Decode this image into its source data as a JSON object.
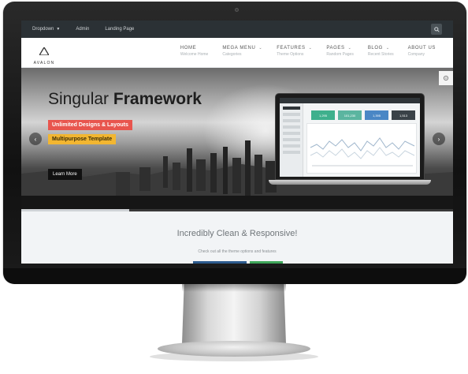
{
  "topbar": {
    "items": [
      {
        "label": "Dropdown",
        "chevron": true
      },
      {
        "label": "Admin",
        "chevron": false
      },
      {
        "label": "Landing Page",
        "chevron": false
      }
    ],
    "search_icon": "search-icon"
  },
  "logo": {
    "text": "AVALON"
  },
  "nav": [
    {
      "title": "HOME",
      "sub": "Welcome Home",
      "chevron": false
    },
    {
      "title": "MEGA MENU",
      "sub": "Categories",
      "chevron": true
    },
    {
      "title": "FEATURES",
      "sub": "Theme Options",
      "chevron": true
    },
    {
      "title": "PAGES",
      "sub": "Random Pages",
      "chevron": true
    },
    {
      "title": "BLOG",
      "sub": "Recent Stories",
      "chevron": true
    },
    {
      "title": "ABOUT US",
      "sub": "Company",
      "chevron": false
    }
  ],
  "hero": {
    "title_regular": "Singular",
    "title_bold": "Framework",
    "tag1": "Unlimited Designs & Layouts",
    "tag2": "Multipurpose Template",
    "button": "Learn More",
    "progress": 0.25
  },
  "laptop": {
    "stats": [
      {
        "value": "1,295",
        "color": "#3fb08d"
      },
      {
        "value": "101,230",
        "color": "#5bb5a0"
      },
      {
        "value": "1,395",
        "color": "#4a87c5"
      },
      {
        "value": "1,513",
        "color": "#3a4248"
      }
    ]
  },
  "section": {
    "title": "Incredibly Clean & Responsive!",
    "subtitle": "Check out all the theme options and features"
  },
  "colors": {
    "topbar": "#2b3135",
    "tag_red": "#e8554e",
    "tag_yellow": "#f2b631",
    "accent_blue": "#2d5b8e",
    "accent_green": "#3fa65a"
  }
}
